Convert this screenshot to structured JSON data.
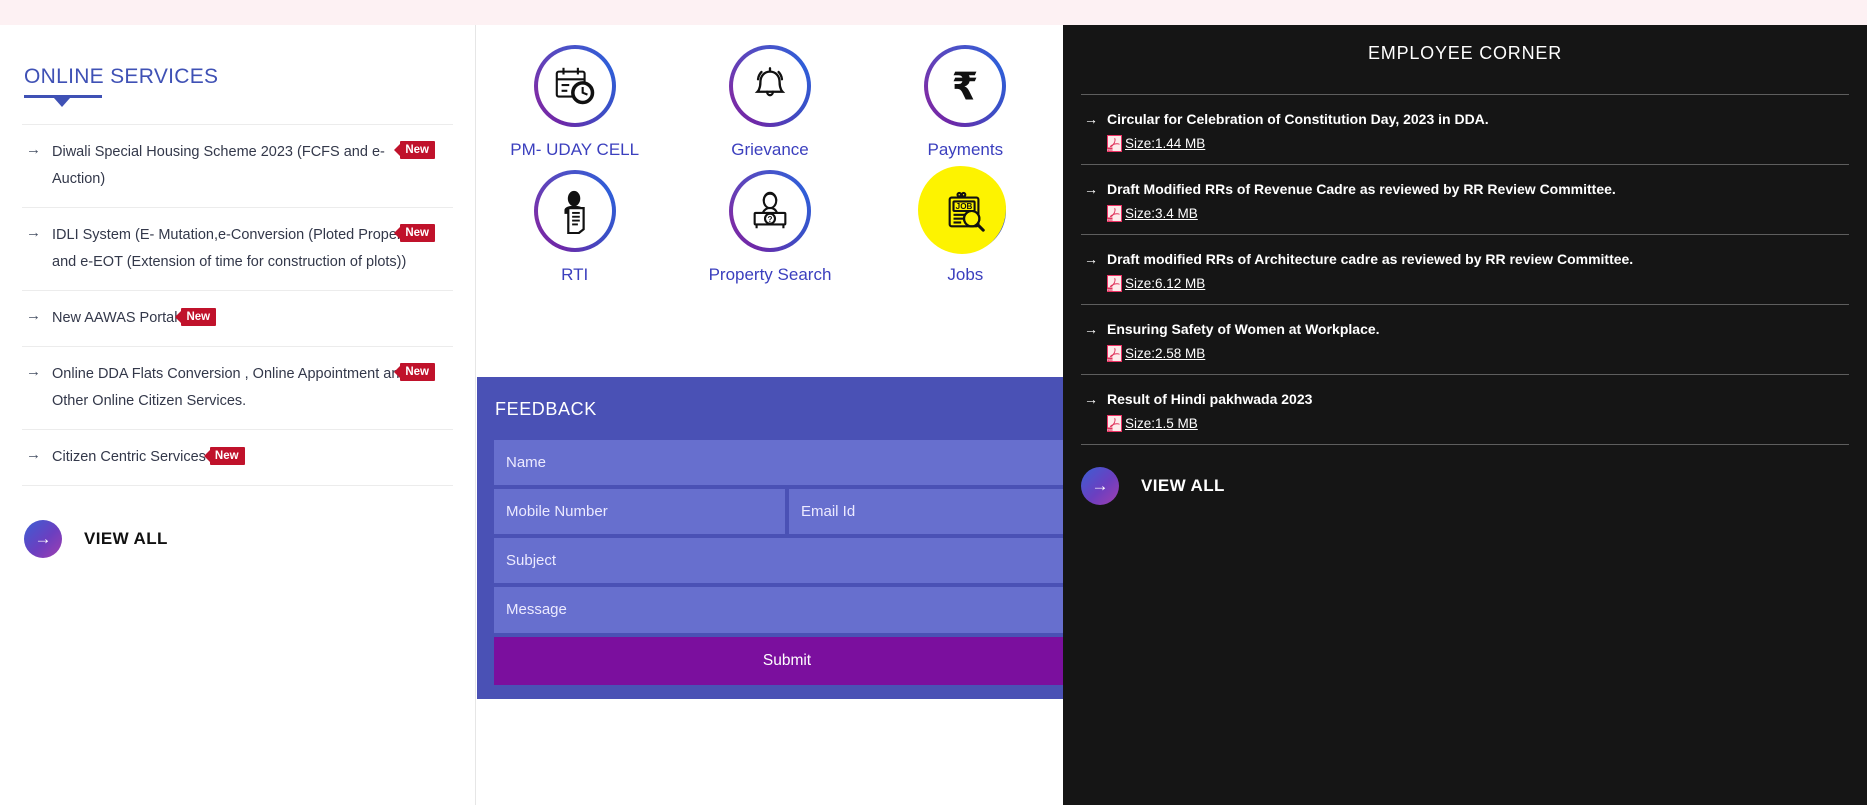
{
  "online_services": {
    "heading": "ONLINE SERVICES",
    "items": [
      {
        "label": "Diwali Special Housing Scheme 2023 (FCFS and e-Auction)",
        "badge": "New",
        "badge_position": "right"
      },
      {
        "label": "IDLI System (E- Mutation,e-Conversion (Ploted Properties) and e-EOT (Extension of time for construction of plots))",
        "badge": "New",
        "badge_position": "right"
      },
      {
        "label": "New AAWAS Portal",
        "badge": "New",
        "badge_position": "inline"
      },
      {
        "label": "Online DDA Flats Conversion , Online Appointment and Other Online Citizen Services.",
        "badge": "New",
        "badge_position": "right"
      },
      {
        "label": "Citizen Centric Services",
        "badge": "New",
        "badge_position": "inline"
      }
    ],
    "view_all_label": "VIEW ALL",
    "view_all_icon": "arrow-right-icon"
  },
  "quick_links": {
    "tiles": [
      {
        "label": "PM- UDAY CELL",
        "icon": "calendar-clock-icon",
        "highlighted": false
      },
      {
        "label": "Grievance",
        "icon": "bell-icon",
        "highlighted": false
      },
      {
        "label": "Payments",
        "icon": "rupee-icon",
        "highlighted": false
      },
      {
        "label": "RTI",
        "icon": "person-document-icon",
        "highlighted": false
      },
      {
        "label": "Property Search",
        "icon": "help-desk-icon",
        "highlighted": false
      },
      {
        "label": "Jobs",
        "icon": "job-search-icon",
        "highlighted": true
      }
    ]
  },
  "feedback": {
    "title": "FEEDBACK",
    "fields": {
      "name_placeholder": "Name",
      "mobile_placeholder": "Mobile Number",
      "email_placeholder": "Email Id",
      "subject_placeholder": "Subject",
      "message_placeholder": "Message"
    },
    "submit_label": "Submit"
  },
  "employee_corner": {
    "title": "EMPLOYEE CORNER",
    "items": [
      {
        "title": "Circular for Celebration of Constitution Day, 2023 in DDA.",
        "size": "Size:1.44 MB"
      },
      {
        "title": "Draft Modified RRs of Revenue Cadre as reviewed by RR Review Committee.",
        "size": "Size:3.4 MB"
      },
      {
        "title": "Draft modified RRs of Architecture cadre as reviewed by RR review Committee.",
        "size": "Size:6.12 MB"
      },
      {
        "title": "Ensuring Safety of Women at Workplace.",
        "size": "Size:2.58 MB"
      },
      {
        "title": "Result of Hindi pakhwada 2023",
        "size": "Size:1.5 MB"
      }
    ],
    "view_all_label": "VIEW ALL",
    "view_all_icon": "arrow-right-icon"
  },
  "colors": {
    "accent_indigo": "#3f51b5",
    "badge_red": "#c0122b",
    "feedback_bg": "#4a51b5",
    "feedback_field": "#676fce",
    "submit_purple": "#7b0f9e",
    "employee_bg": "#151515",
    "highlight_yellow": "#fdf300",
    "icon_label_blue": "#3b3fbe"
  }
}
